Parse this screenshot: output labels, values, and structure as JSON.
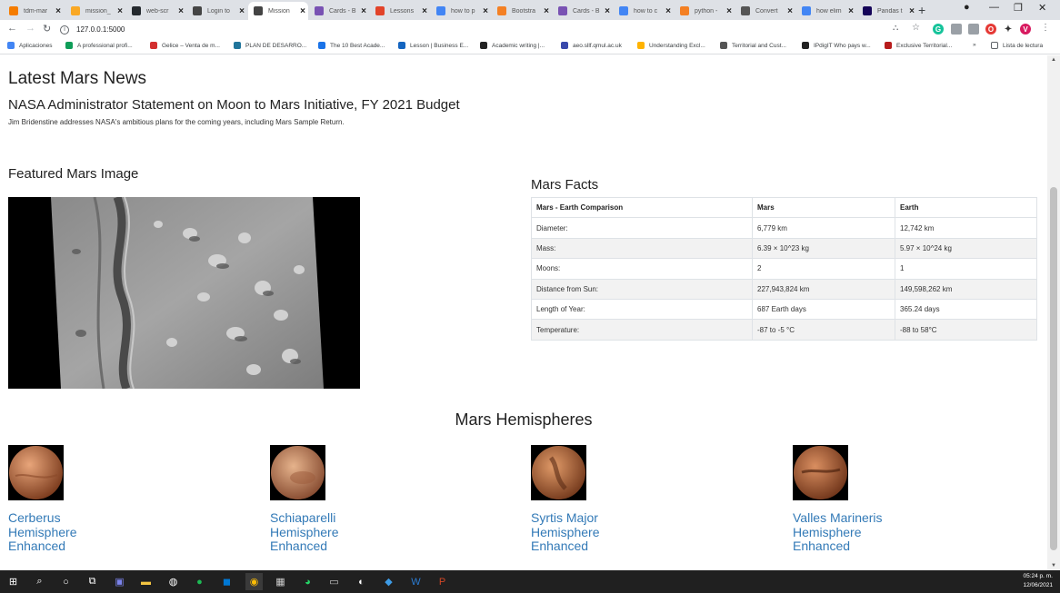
{
  "browser": {
    "tabs": [
      {
        "label": "tdm-mar",
        "icon": "circle-icon",
        "color": "#f57c00"
      },
      {
        "label": "mission_",
        "icon": "document-icon",
        "color": "#f9a825"
      },
      {
        "label": "web-scr",
        "icon": "github-icon",
        "color": "#24292e"
      },
      {
        "label": "Login to",
        "icon": "globe-icon",
        "color": "#444"
      },
      {
        "label": "Mission",
        "icon": "globe-icon",
        "color": "#444",
        "active": true
      },
      {
        "label": "Cards - B",
        "icon": "bootstrap-icon",
        "color": "#7952b3"
      },
      {
        "label": "Lessons",
        "icon": "gitlab-icon",
        "color": "#e24329"
      },
      {
        "label": "how to p",
        "icon": "google-icon",
        "color": "#4285f4"
      },
      {
        "label": "Bootstra",
        "icon": "search-icon",
        "color": "#f48024"
      },
      {
        "label": "Cards - B",
        "icon": "bootstrap-icon",
        "color": "#7952b3"
      },
      {
        "label": "how to c",
        "icon": "google-icon",
        "color": "#4285f4"
      },
      {
        "label": "python -",
        "icon": "stackoverflow-icon",
        "color": "#f48024"
      },
      {
        "label": "Convert",
        "icon": "pt-icon",
        "color": "#555"
      },
      {
        "label": "how elim",
        "icon": "google-icon",
        "color": "#4285f4"
      },
      {
        "label": "Pandas t",
        "icon": "pandas-icon",
        "color": "#150458"
      }
    ],
    "url": "127.0.0.1:5000",
    "bookmarks": [
      {
        "label": "Aplicaciones",
        "color": "#4285f4"
      },
      {
        "label": "A professional profi...",
        "color": "#0f9d58"
      },
      {
        "label": "Gelice – Venta de m...",
        "color": "#d32f2f"
      },
      {
        "label": "PLAN DE DESARRO...",
        "color": "#21759b"
      },
      {
        "label": "The 10 Best Acade...",
        "color": "#1a73e8"
      },
      {
        "label": "Lesson | Business E...",
        "color": "#1565c0"
      },
      {
        "label": "Academic writing |...",
        "color": "#222"
      },
      {
        "label": "aeo.sllf.qmul.ac.uk",
        "color": "#3949ab"
      },
      {
        "label": "Understanding Excl...",
        "color": "#ffb300"
      },
      {
        "label": "Territorial and Cust...",
        "color": "#555"
      },
      {
        "label": "IPdigIT Who pays w...",
        "color": "#222"
      },
      {
        "label": "Exclusive Territorial...",
        "color": "#b71c1c"
      }
    ],
    "bookmarks_more": "»",
    "reading_list": "Lista de lectura"
  },
  "page": {
    "news_heading": "Latest Mars News",
    "news_title": "NASA Administrator Statement on Moon to Mars Initiative, FY 2021 Budget",
    "news_paragraph": "Jim Bridenstine addresses NASA's ambitious plans for the coming years, including Mars Sample Return.",
    "featured_heading": "Featured Mars Image",
    "facts_heading": "Mars Facts",
    "facts_table": {
      "headers": [
        "Mars - Earth Comparison",
        "Mars",
        "Earth"
      ],
      "rows": [
        [
          "Diameter:",
          "6,779 km",
          "12,742 km"
        ],
        [
          "Mass:",
          "6.39 × 10^23 kg",
          "5.97 × 10^24 kg"
        ],
        [
          "Moons:",
          "2",
          "1"
        ],
        [
          "Distance from Sun:",
          "227,943,824 km",
          "149,598,262 km"
        ],
        [
          "Length of Year:",
          "687 Earth days",
          "365.24 days"
        ],
        [
          "Temperature:",
          "-87 to -5 °C",
          "-88 to 58°C"
        ]
      ]
    },
    "hemispheres_heading": "Mars Hemispheres",
    "hemispheres": [
      {
        "title": "Cerberus Hemisphere Enhanced",
        "color": "#c06a3a"
      },
      {
        "title": "Schiaparelli Hemisphere Enhanced",
        "color": "#c27a4e"
      },
      {
        "title": "Syrtis Major Hemisphere Enhanced",
        "color": "#b2603a"
      },
      {
        "title": "Valles Marineris Hemisphere Enhanced",
        "color": "#a9552f"
      }
    ]
  },
  "taskbar": {
    "time": "05:24 p. m.",
    "date": "12/06/2021"
  }
}
